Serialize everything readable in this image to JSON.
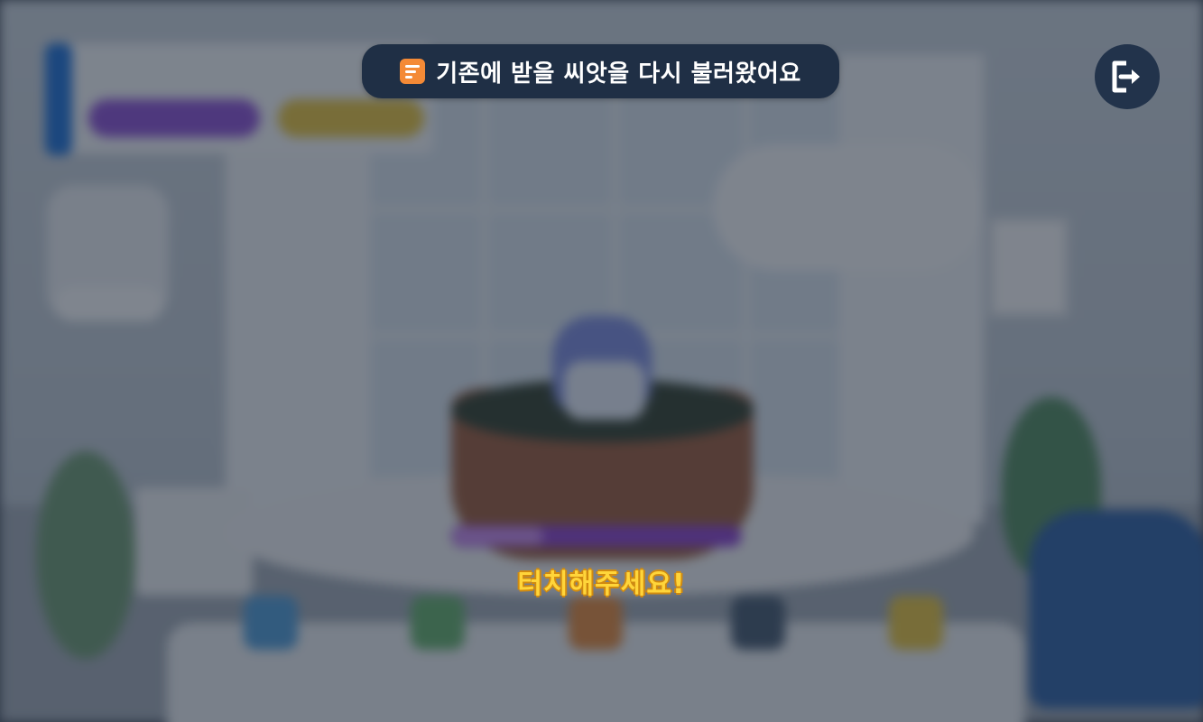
{
  "notice": {
    "icon": "note-icon",
    "text": "기존에 받을 씨앗을 다시 불러왔어요",
    "bg_color": "#1f2f45",
    "icon_color": "#f48a36"
  },
  "exit_button": {
    "icon": "exit-icon"
  },
  "prompt": {
    "text": "터치해주세요!",
    "color": "#ffd53a"
  }
}
